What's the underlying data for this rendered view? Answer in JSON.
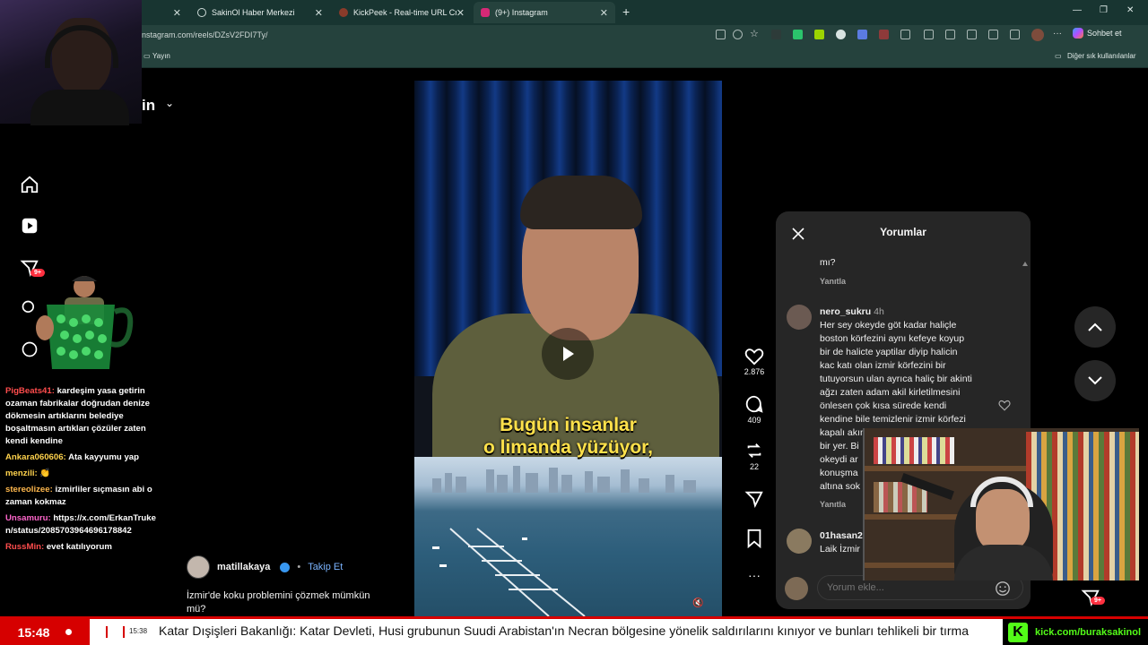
{
  "browser": {
    "tabs": [
      {
        "label": "",
        "icon": "globe-icon",
        "color": "#6e8b86"
      },
      {
        "label": "SakinOl Haber Merkezi",
        "icon": "globe-icon",
        "color": "#9fb3b0"
      },
      {
        "label": "KickPeek - Real-time URL Crawler",
        "icon": "kickpeek-icon",
        "color": "#8a3b2a"
      },
      {
        "label": "(9+) Instagram",
        "icon": "instagram-icon",
        "color": "#d62976"
      }
    ],
    "url": "nstagram.com/reels/DZsV2FDI7Ty/",
    "chat_label": "Sohbet et",
    "bookmark_left": "Yayın",
    "bookmark_right": "Diğer sık kullanılanlar"
  },
  "instagram": {
    "logo_fragment": "in",
    "sidebar_badge": "9+",
    "video_caption_line1": "Bugün insanlar",
    "video_caption_line2": "o limanda yüzüyor,",
    "likes": "2.876",
    "comments_count": "409",
    "shares": "22",
    "author": "matillakaya",
    "follow_label": "Takip Et",
    "separator": "•",
    "description_line1": "İzmir'de koku problemini çözmek mümkün",
    "description_line2": "mü?"
  },
  "comments_panel": {
    "title": "Yorumlar",
    "partial_text": "mı?",
    "reply_label": "Yanıtla",
    "comment1": {
      "user": "nero_sukru",
      "time": "4h",
      "lines": [
        "Her sey okeyde göt kadar haliçle",
        "boston körfezini aynı kefeye koyup",
        "bir de halicte yaptilar diyip halicin",
        "kac katı olan izmir körfezini bir",
        "tutuyorsun ulan ayrıca haliç bir akinti",
        "ağzı zaten adam akil kirletilmesini",
        "önlesen çok kısa sürede kendi",
        "kendine bile temizlenir izmir körfezi",
        "kapalı akınt",
        "bir yer. Bi",
        "okeydi ar",
        "konuşma",
        "altına sok"
      ]
    },
    "comment2": {
      "user": "01hasan2",
      "line": "Laik İzmir"
    },
    "input_placeholder": "Yorum ekle...",
    "nav_badge": "9+"
  },
  "stream_chat": [
    {
      "user": "PigBeats41:",
      "text": "kardeşim yasa getirin ozaman fabrikalar doğrudan denize dökmesin artıklarını belediye boşaltmasın artıkları çözüler zaten kendi kendine",
      "color": "#ff4d4d"
    },
    {
      "user": "Ankara060606:",
      "text": "Ata kayyumu yap",
      "color": "#ffd34d"
    },
    {
      "user": "menzili:",
      "text": "👏",
      "color": "#ffd34d"
    },
    {
      "user": "stereolizee:",
      "text": "izmirliler sıçmasın abi o zaman kokmaz",
      "color": "#ffb84d"
    },
    {
      "user": "Unsamuru:",
      "text": "https://x.com/ErkanTruken/status/2085703964696178842",
      "color": "#ff66cc"
    },
    {
      "user": "RussMin:",
      "text": "evet katılıyorum",
      "color": "#ff4d4d"
    }
  ],
  "ticker": {
    "clock": "15:48",
    "item_time": "15:38",
    "headline": "Katar Dışişleri Bakanlığı: Katar Devleti, Husi grubunun Suudi Arabistan'ın Necran bölgesine yönelik saldırılarını kınıyor ve bunları tehlikeli bir tırma",
    "kick_url": "kick.com/buraksakinol",
    "kick_logo": "K"
  },
  "colors": {
    "accent_red": "#d60000",
    "kick_green": "#53fc18",
    "instagram_badge": "#ff3040",
    "verified_blue": "#3897f0"
  }
}
